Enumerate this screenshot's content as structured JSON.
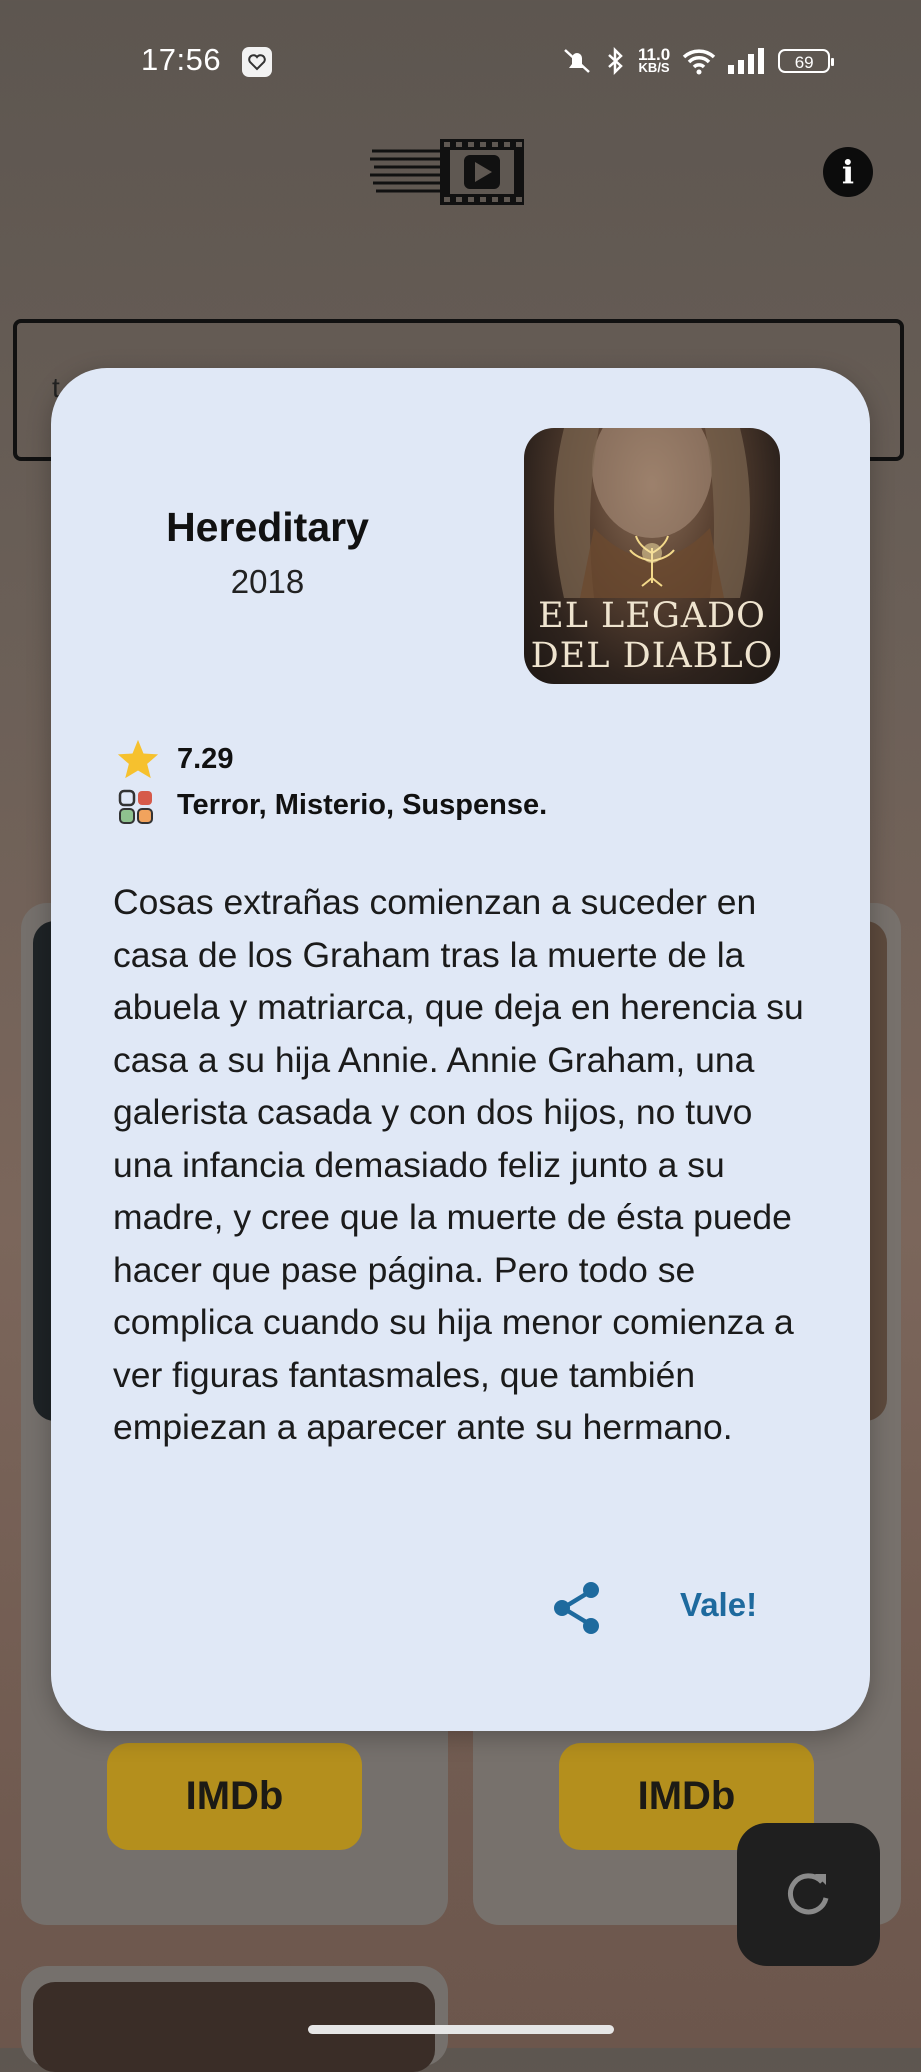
{
  "status_bar": {
    "time": "17:56",
    "speed_value": "11.0",
    "speed_unit": "KB/S",
    "battery": "69"
  },
  "search": {
    "value": "t"
  },
  "cards": [
    {
      "imdb_label": "IMDb"
    },
    {
      "imdb_label": "IMDb"
    }
  ],
  "dialog": {
    "title": "Hereditary",
    "year": "2018",
    "poster_line1": "EL LEGADO",
    "poster_line2": "DEL DIABLO",
    "rating": "7.29",
    "genres": "Terror, Misterio, Suspense.",
    "synopsis": "Cosas extrañas comienzan a suceder en casa de los Graham tras la muerte de la abuela y matriarca, que deja en herencia su casa a su hija Annie. Annie Graham, una galerista casada y con dos hijos, no tuvo una infancia demasiado feliz junto a su madre, y cree que la muerte de ésta puede hacer que pase página. Pero todo se complica cuando su hija menor comienza a ver figuras fantasmales, que también empiezan a aparecer ante su hermano.",
    "ok_label": "Vale!"
  },
  "colors": {
    "dialog_bg": "#e0e8f6",
    "accent": "#1e6a9e",
    "imdb": "#b48f1d",
    "star": "#f6c12e"
  },
  "icons": {
    "star": "star-icon",
    "genres": "grid-icon",
    "share": "share-icon",
    "refresh": "refresh-icon",
    "info": "info-icon"
  }
}
